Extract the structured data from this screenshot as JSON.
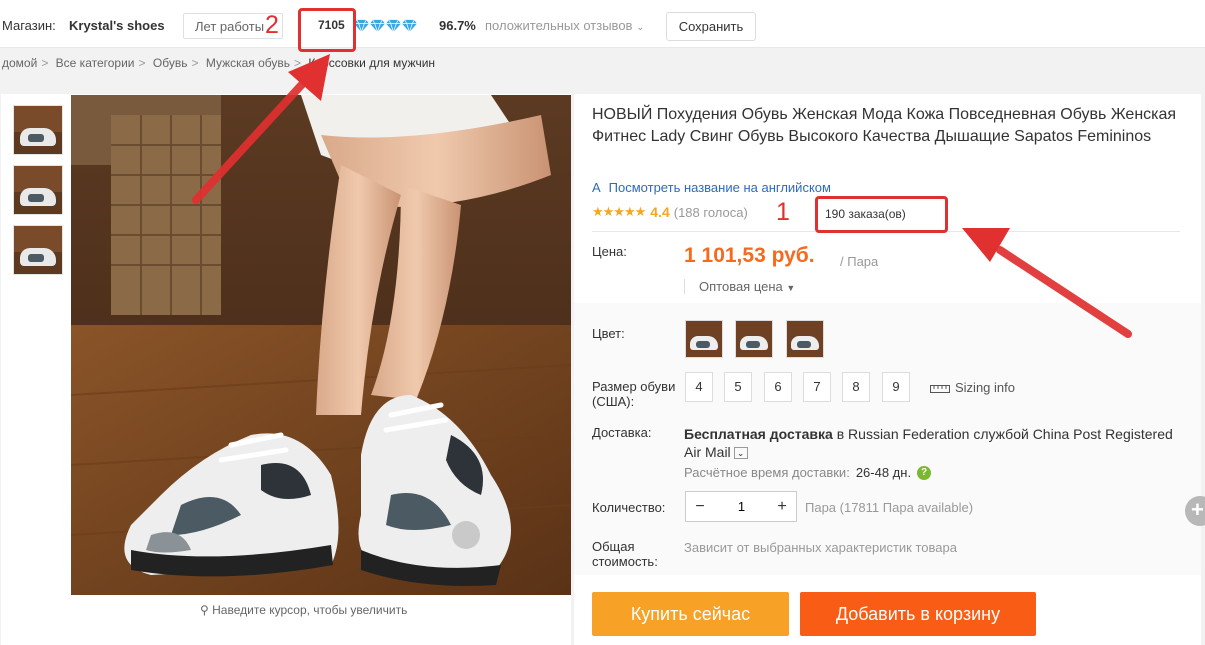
{
  "store": {
    "label": "Магазин:",
    "name": "Krystal's shoes",
    "years": "Лет работы",
    "score": "7105",
    "diamond_icon": "diamond-icon",
    "positive_pct": "96.7%",
    "feedback_label": "положительных отзывов",
    "save_label": "Сохранить"
  },
  "breadcrumb": [
    "домой",
    "Все категории",
    "Обувь",
    "Мужская обувь",
    "Кроссовки для мужчин"
  ],
  "gallery": {
    "zoom_hint": "Наведите курсор, чтобы увеличить"
  },
  "product": {
    "title": "НОВЫЙ Похудения Обувь Женская Мода Кожа Повседневная Обувь Женская Фитнес Lady Свинг Обувь Высокого Качества Дышащие Sapatos Femininos",
    "translate_icon": "А",
    "translate_link": "Посмотреть название на английском",
    "rating": "4.4",
    "votes": "(188 голоса)",
    "orders": "190 заказа(ов)",
    "price_label": "Цена:",
    "price": "1 101,53 руб.",
    "unit": "/ Пара",
    "wholesale": "Оптовая цена",
    "color_label": "Цвет:",
    "size_label": "Размер обуви (США):",
    "sizes": [
      "4",
      "5",
      "6",
      "7",
      "8",
      "9"
    ],
    "sizing_info": "Sizing info",
    "shipping_label": "Доставка:",
    "shipping_bold": "Бесплатная доставка",
    "shipping_rest": " в Russian Federation службой China Post Registered Air Mail",
    "eta_label": "Расчётное время доставки:",
    "eta_days": "26-48 дн.",
    "qty_label": "Количество:",
    "qty_value": "1",
    "available": "Пара (17811 Пара available)",
    "total_label": "Общая стоимость:",
    "total_text": "Зависит от выбранных характеристик товара",
    "buy_now": "Купить сейчас",
    "add_to_cart": "Добавить в корзину"
  },
  "annotations": {
    "mark1": "1",
    "mark2": "2"
  },
  "colors": {
    "price": "#f56b1e",
    "buy": "#f7a227",
    "cart": "#f95c14",
    "annotation": "#e03030",
    "link": "#2c6bbd"
  }
}
